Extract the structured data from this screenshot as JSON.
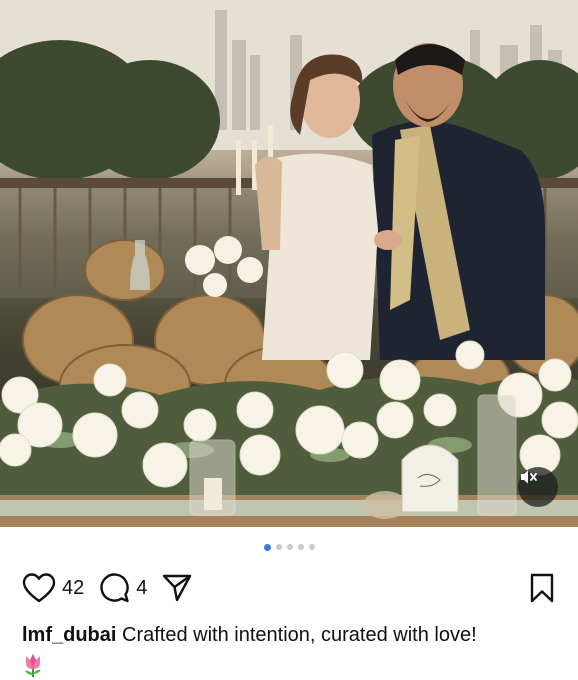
{
  "post": {
    "username": "lmf_dubai",
    "caption": "Crafted with intention, curated with love!",
    "caption_emoji": "tulip-icon"
  },
  "actions": {
    "like_count": "42",
    "comment_count": "4"
  },
  "carousel": {
    "total": 5,
    "active_index": 0
  },
  "colors": {
    "active_dot": "#3a7bd5",
    "inactive_dot": "#c9c9c9"
  },
  "icons": {
    "like": "heart-icon",
    "comment": "comment-bubble-icon",
    "share": "paper-plane-icon",
    "save": "bookmark-icon",
    "mute": "speaker-muted-icon"
  }
}
